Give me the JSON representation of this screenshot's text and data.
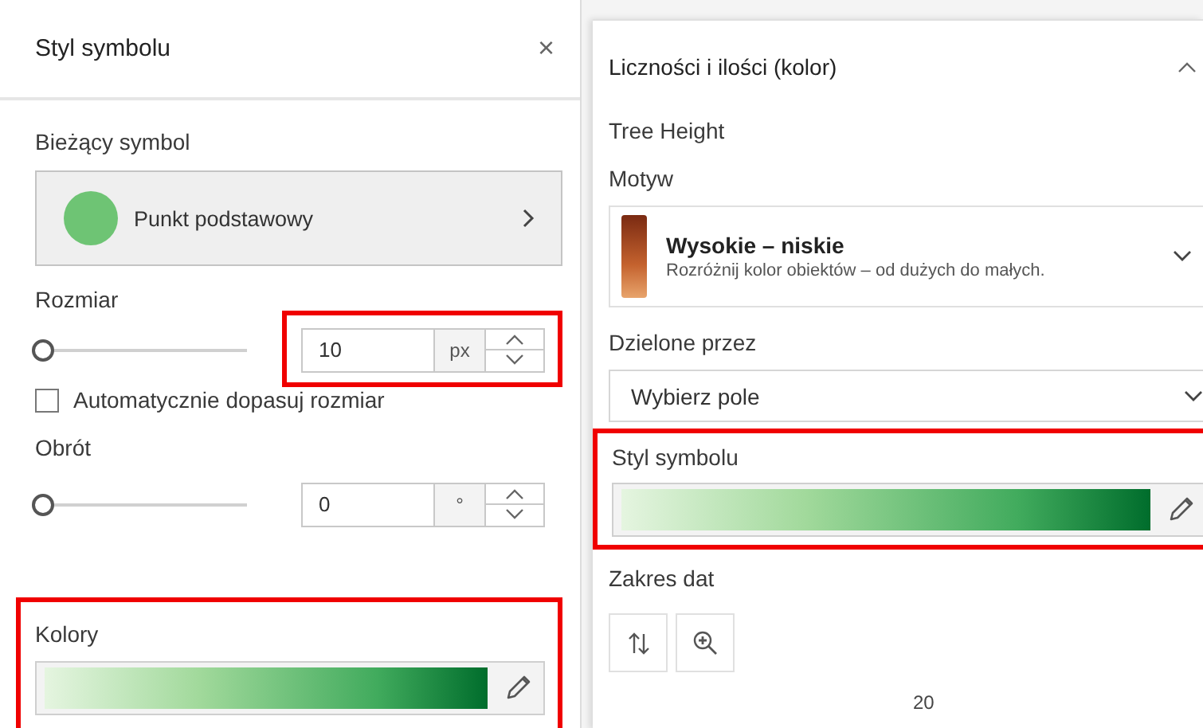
{
  "left_panel": {
    "title": "Styl symbolu",
    "close": "×",
    "current_symbol": {
      "label": "Bieżący symbol",
      "name": "Punkt podstawowy"
    },
    "size": {
      "label": "Rozmiar",
      "level": 0,
      "value": "10",
      "unit": "px",
      "highlighted": true
    },
    "auto_size": {
      "label": "Automatycznie dopasuj rozmiar",
      "checked": false
    },
    "rotation": {
      "label": "Obrót",
      "level": 0,
      "value": "0",
      "unit": "°",
      "highlighted": false
    },
    "colors": {
      "label": "Kolory",
      "highlighted": true
    }
  },
  "right_panel": {
    "title": "Liczności i ilości (kolor)",
    "expanded": true,
    "field": "Tree Height",
    "theme": {
      "label": "Motyw",
      "name": "Wysokie – niskie",
      "description": "Rozróżnij kolor obiektów – od dużych do małych."
    },
    "divided_by": {
      "label": "Dzielone przez",
      "value": "Wybierz pole"
    },
    "symbol_style": {
      "label": "Styl symbolu",
      "highlighted": true
    },
    "date_range": {
      "label": "Zakres dat",
      "axis_label": "20"
    }
  }
}
